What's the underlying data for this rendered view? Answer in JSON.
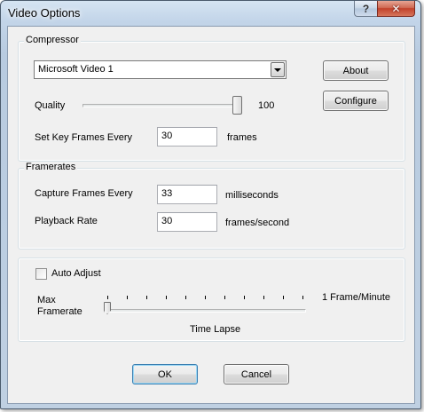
{
  "window": {
    "title": "Video Options"
  },
  "titlebar": {
    "help_glyph": "?",
    "close_glyph": "✕"
  },
  "compressor": {
    "group_title": "Compressor",
    "codec_selected": "Microsoft Video 1",
    "about_label": "About",
    "configure_label": "Configure",
    "quality_label": "Quality",
    "quality_value": "100",
    "quality_fraction": 1.0,
    "keyframes_label": "Set Key Frames Every",
    "keyframes_value": "30",
    "keyframes_unit": "frames"
  },
  "framerates": {
    "group_title": "Framerates",
    "capture_label": "Capture Frames Every",
    "capture_value": "33",
    "capture_unit": "milliseconds",
    "playback_label": "Playback Rate",
    "playback_value": "30",
    "playback_unit": "frames/second"
  },
  "timelapse": {
    "auto_adjust_label": "Auto Adjust",
    "auto_adjust_checked": false,
    "max_label_line1": "Max",
    "max_label_line2": "Framerate",
    "min_label": "1 Frame/Minute",
    "caption": "Time Lapse",
    "slider_fraction": 0.0,
    "tick_count": 11
  },
  "footer": {
    "ok_label": "OK",
    "cancel_label": "Cancel"
  }
}
